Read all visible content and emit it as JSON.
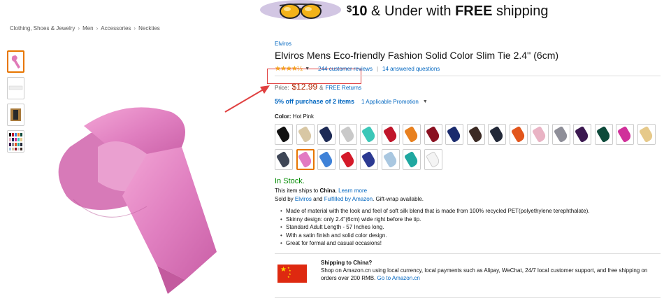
{
  "banner": {
    "dollar": "$",
    "amount": "10",
    "text": " & Under with ",
    "free": "FREE",
    "shipping": " shipping"
  },
  "breadcrumb": [
    "Clothing, Shoes & Jewelry",
    "Men",
    "Accessories",
    "Neckties"
  ],
  "breadcrumb_sep": "›",
  "product": {
    "brand": "Elviros",
    "title": "Elviros Mens Eco-friendly Fashion Solid Color Slim Tie 2.4'' (6cm)",
    "rating_stars": "★★★★½",
    "reviews": "244 customer reviews",
    "answered": "14 answered questions",
    "price_label": "Price:",
    "price": "$12.99",
    "price_amp": "&",
    "free_returns": "FREE Returns",
    "promo": "5% off purchase of 2 items",
    "promo_link": "1 Applicable Promotion",
    "color_label": "Color:",
    "color_value": "Hot Pink",
    "stock": "In Stock.",
    "ships_prefix": "This item ships to ",
    "ships_country": "China",
    "ships_suffix": ". ",
    "learn_more": "Learn more",
    "sold_by_prefix": "Sold by ",
    "seller": "Elviros",
    "and": " and ",
    "fulfilled": "Fulfilled by Amazon",
    "giftwrap": ". Gift-wrap available.",
    "bullets": [
      "Made of material with the look and feel of soft silk blend that is made from 100% recycled PET(polyethylene terephthalate).",
      "Skinny design: only 2.4''(6cm) wide right before the tip.",
      "Standard Adult Length - 57 Inches long.",
      "With a satin finish and solid color design.",
      "Great for formal and casual occasions!"
    ]
  },
  "shipping": {
    "title": "Shipping to China?",
    "body": "Shop on Amazon.cn using local currency, local payments such as Alipay, WeChat, 24/7 local customer support, and free shipping on orders over 200 RMB.",
    "link": "Go to Amazon.cn"
  },
  "swatch_colors": [
    "#111111",
    "#d8c7a4",
    "#1d2a55",
    "#c9c9c9",
    "#3cc7b8",
    "#c0152a",
    "#e8801f",
    "#8a1020",
    "#1a2b6e",
    "#3b2a24",
    "#222838",
    "#e2561c",
    "#e9b3c4",
    "#8e8e98",
    "#3b1850",
    "#0d4a3a",
    "#d0309a",
    "#e6c98a",
    "#3e4656",
    "#e27ac2",
    "#3f82d8",
    "#d41a2a",
    "#2c3a92",
    "#a9c7e0",
    "#1fa7a0",
    "#f4f4f4"
  ],
  "selected_swatch": 19,
  "colors": {
    "link": "#0066c0",
    "price": "#b12704",
    "stock": "#008a00",
    "selected_border": "#e77600",
    "annotation": "#e04040"
  }
}
